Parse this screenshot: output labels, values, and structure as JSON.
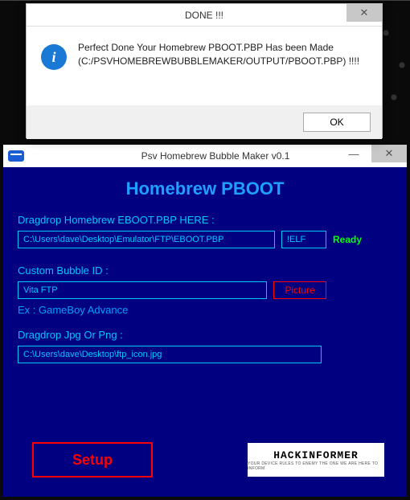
{
  "dialog": {
    "title": "DONE !!!",
    "message": "Perfect Done Your Homebrew PBOOT.PBP Has been Made (C:/PSVHOMEBREWBUBBLEMAKER/OUTPUT/PBOOT.PBP) !!!!",
    "ok_label": "OK",
    "close_glyph": "✕",
    "info_glyph": "i"
  },
  "app": {
    "title": "Psv Homebrew Bubble Maker v0.1",
    "minimize_glyph": "—",
    "close_glyph": "✕",
    "heading": "Homebrew PBOOT",
    "eboot_label": "Dragdrop Homebrew EBOOT.PBP HERE :",
    "eboot_value": "C:\\Users\\dave\\Desktop\\Emulator\\FTP\\EBOOT.PBP",
    "elf_value": "!ELF",
    "ready_label": "Ready",
    "bubble_label": "Custom Bubble ID :",
    "bubble_value": "Vita FTP",
    "picture_label": "Picture",
    "example_label": "Ex : GameBoy Advance",
    "img_label": "Dragdrop Jpg Or Png :",
    "img_value": "C:\\Users\\dave\\Desktop\\ftp_icon.jpg",
    "setup_label": "Setup",
    "logo_text": "HACKINFORMER",
    "logo_sub": "YOUR DEVICE RULES TO ENEMY THE ONE WE ARE HERE TO INFORM"
  }
}
